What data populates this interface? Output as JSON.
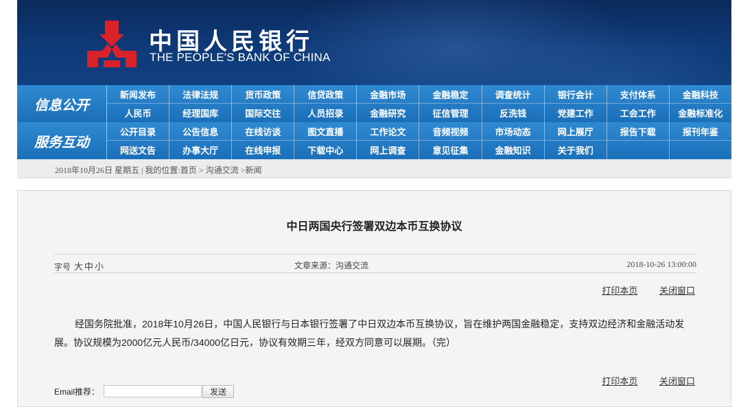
{
  "header": {
    "title_cn": "中国人民银行",
    "title_en": "THE PEOPLE'S BANK OF CHINA",
    "logo_icon": "pboc-emblem-icon",
    "brand_red": "#d9222a",
    "bg_color": "#0e3a78"
  },
  "nav": {
    "accent": "#2f8ad2",
    "section1": {
      "label": "信息公开",
      "row1": [
        "新闻发布",
        "法律法规",
        "货币政策",
        "信贷政策",
        "金融市场",
        "金融稳定",
        "调查统计",
        "银行会计",
        "支付体系",
        "金融科技"
      ],
      "row2": [
        "人民币",
        "经理国库",
        "国际交往",
        "人员招录",
        "金融研究",
        "征信管理",
        "反洗钱",
        "党建工作",
        "工会工作",
        "金融标准化"
      ]
    },
    "section2": {
      "label": "服务互动",
      "row1": [
        "公开目录",
        "公告信息",
        "在线访谈",
        "图文直播",
        "工作论文",
        "音频视频",
        "市场动态",
        "网上展厅",
        "报告下载",
        "报刊年鉴"
      ],
      "row2": [
        "网送文告",
        "办事大厅",
        "在线申报",
        "下载中心",
        "网上调查",
        "意见征集",
        "金融知识",
        "关于我们",
        "",
        ""
      ]
    }
  },
  "breadcrumb": {
    "date": "2018年10月26日 星期五",
    "sep": "|",
    "prefix": "我的位置:",
    "items": [
      "首页",
      "沟通交流",
      "新闻"
    ],
    "arrow": ">"
  },
  "article": {
    "title": "中日两国央行签署双边本币互换协议",
    "font_size_label": "字号",
    "font_size_options": [
      "大",
      "中",
      "小"
    ],
    "source": "文章来源：沟通交流",
    "datetime": "2018-10-26 13:00:00",
    "print_label": "打印本页",
    "close_label": "关闭窗口",
    "body": "经国务院批准，2018年10月26日，中国人民银行与日本银行签署了中日双边本币互换协议，旨在维护两国金融稳定，支持双边经济和金融活动发展。协议规模为2000亿元人民币/34000亿日元，协议有效期三年，经双方同意可以展期。（完）"
  },
  "email": {
    "label": "Email推荐：",
    "value": "",
    "send_label": "发送"
  }
}
